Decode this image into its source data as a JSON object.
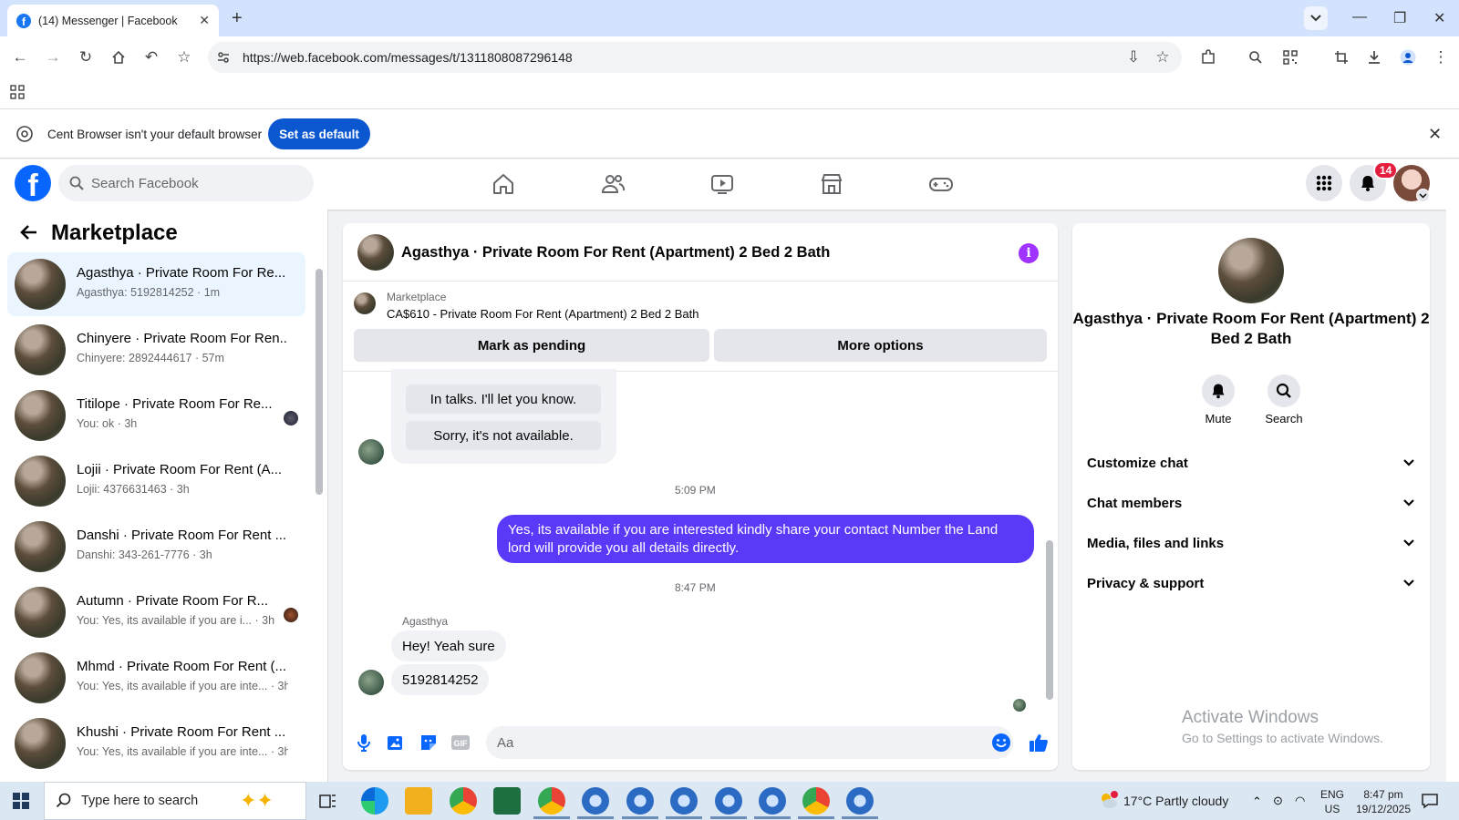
{
  "browser": {
    "tab_title": "(14) Messenger | Facebook",
    "tab_close": "✕",
    "new_tab": "+",
    "url": "https://web.facebook.com/messages/t/1311808087296148",
    "infobar_text": "Cent Browser isn't your default browser",
    "set_default_label": "Set as default"
  },
  "fb": {
    "logo": "f",
    "search_placeholder": "Search Facebook",
    "notification_count": "14",
    "brand_color": "#0866ff"
  },
  "sidebar": {
    "title": "Marketplace",
    "conversations": [
      {
        "name": "Agasthya · Private Room For Re...",
        "sub": "Agasthya: 5192814252 · 1m",
        "active": true
      },
      {
        "name": "Chinyere · Private Room For Ren...",
        "sub": "Chinyere: 2892444617 · 57m"
      },
      {
        "name": "Titilope · Private Room For Re...",
        "sub": "You: ok · 3h"
      },
      {
        "name": "Lojii · Private Room For Rent (A...",
        "sub": "Lojii: 4376631463 · 3h"
      },
      {
        "name": "Danshi · Private Room For Rent ...",
        "sub": "Danshi: 343-261-7776 · 3h"
      },
      {
        "name": "Autumn · Private Room For R...",
        "sub": "You: Yes, its available if you are i... · 3h"
      },
      {
        "name": "Mhmd · Private Room For Rent (...",
        "sub": "You: Yes, its available if you are inte... · 3h"
      },
      {
        "name": "Khushi · Private Room For Rent ...",
        "sub": "You: Yes, its available if you are inte... · 3h"
      }
    ]
  },
  "chat": {
    "title": "Agasthya · Private Room For Rent (Apartment) 2 Bed 2 Bath",
    "listing_label": "Marketplace",
    "listing_price": "CA$610 - Private Room For Rent (Apartment) 2 Bed 2 Bath",
    "mark_pending": "Mark as pending",
    "more_options": "More options",
    "quick_replies": [
      "In talks. I'll let you know.",
      "Sorry, it's not available."
    ],
    "time_1": "5:09 PM",
    "outgoing": "Yes, its available if you are interested kindly share your contact Number the Land lord will provide you all details directly.",
    "time_2": "8:47 PM",
    "sender": "Agasthya",
    "incoming": [
      "Hey! Yeah sure",
      "5192814252"
    ],
    "input_placeholder": "Aa",
    "accent_color": "#5b39f8"
  },
  "info_panel": {
    "name": "Agasthya · Private Room For Rent (Apartment) 2 Bed 2 Bath",
    "mute": "Mute",
    "search": "Search",
    "rows": [
      "Customize chat",
      "Chat members",
      "Media, files and links",
      "Privacy & support"
    ],
    "activate_title": "Activate Windows",
    "activate_sub": "Go to Settings to activate Windows."
  },
  "taskbar": {
    "search_placeholder": "Type here to search",
    "weather": "17°C  Partly cloudy",
    "lang_1": "ENG",
    "lang_2": "US",
    "time": "8:47 pm",
    "date": "19/12/2025"
  }
}
